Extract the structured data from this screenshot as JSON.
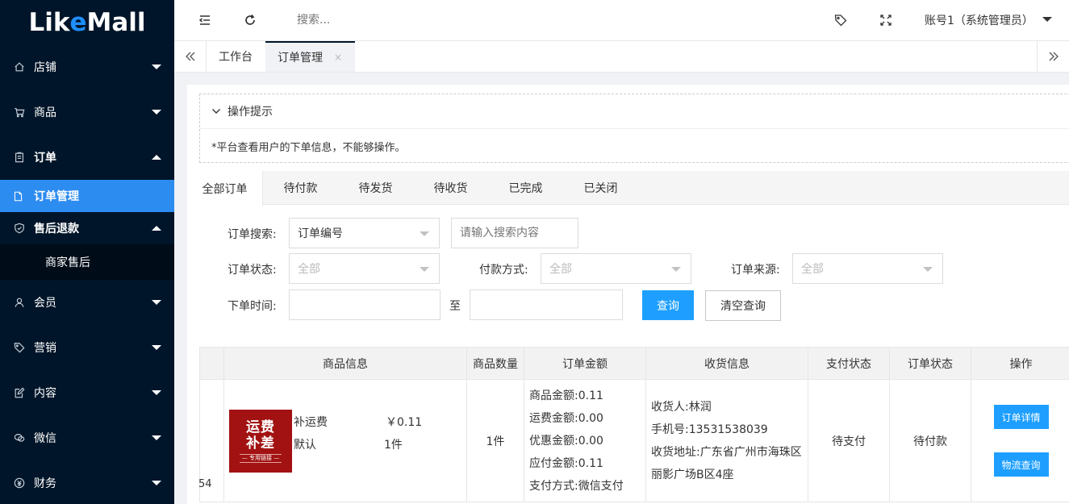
{
  "app": {
    "logo_part1": "Lik",
    "logo_part2": "e",
    "logo_part3": "Mall"
  },
  "sidebar": {
    "items": [
      {
        "label": "店铺",
        "icon": "home-icon"
      },
      {
        "label": "商品",
        "icon": "cart-icon"
      },
      {
        "label": "订单",
        "icon": "clipboard-icon"
      },
      {
        "label": "订单管理",
        "icon": "file-icon"
      },
      {
        "label": "售后退款",
        "icon": "shield-check-icon"
      },
      {
        "label": "商家售后"
      },
      {
        "label": "会员",
        "icon": "user-icon"
      },
      {
        "label": "营销",
        "icon": "tag-icon"
      },
      {
        "label": "内容",
        "icon": "edit-icon"
      },
      {
        "label": "微信",
        "icon": "wechat-icon"
      },
      {
        "label": "财务",
        "icon": "money-icon"
      }
    ]
  },
  "header": {
    "search_placeholder": "搜索...",
    "account": "账号1（系统管理员）"
  },
  "tabbar": {
    "tabs": [
      {
        "label": "工作台"
      },
      {
        "label": "订单管理",
        "close": "×"
      }
    ]
  },
  "tips": {
    "title": "操作提示",
    "text": "*平台查看用户的下单信息，不能够操作。"
  },
  "order_tabs": [
    "全部订单",
    "待付款",
    "待发货",
    "待收货",
    "已完成",
    "已关闭"
  ],
  "filters": {
    "search_label": "订单搜索:",
    "search_type": "订单编号",
    "search_placeholder": "请输入搜索内容",
    "status_label": "订单状态:",
    "status_value": "全部",
    "pay_label": "付款方式:",
    "pay_value": "全部",
    "source_label": "订单来源:",
    "source_value": "全部",
    "time_label": "下单时间:",
    "time_to": "至",
    "query_button": "查询",
    "clear_button": "清空查询"
  },
  "table": {
    "headers": [
      "商品信息",
      "商品数量",
      "订单金额",
      "收货信息",
      "支付状态",
      "订单状态",
      "操作"
    ],
    "row": {
      "id_fragment": "54",
      "image_line1": "运费",
      "image_line2": "补差",
      "image_line3": "— 专用链接 —",
      "goods_name": "补运费",
      "goods_price": "￥0.11",
      "goods_spec": "默认",
      "goods_qty": "1件",
      "quantity": "1件",
      "amounts": [
        "商品金额:0.11",
        "运费金额:0.00",
        "优惠金额:0.00",
        "应付金额:0.11",
        "支付方式:微信支付"
      ],
      "receiver": [
        "收货人:林润",
        "手机号:13531538039",
        "收货地址:广东省广州市海珠区",
        "丽影广场B区4座"
      ],
      "pay_status": "待支付",
      "order_status": "待付款",
      "detail_button": "订单详情",
      "logistics_button": "物流查询"
    }
  },
  "colors": {
    "sidebar_bg": "#001529",
    "active_blue": "#2d8cf0",
    "primary_button": "#1e9fff",
    "goods_image_bg": "#a21212"
  }
}
